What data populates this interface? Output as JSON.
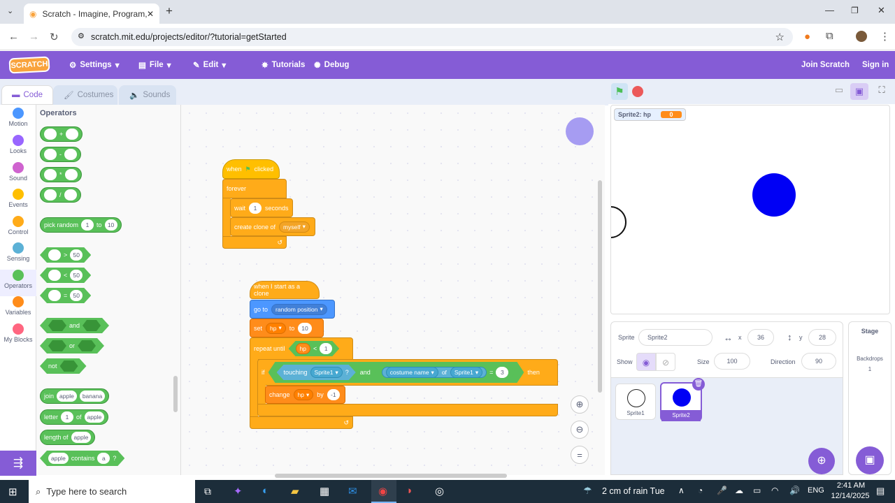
{
  "browser": {
    "tab_title": "Scratch - Imagine, Program, Sh",
    "url": "scratch.mit.edu/projects/editor/?tutorial=getStarted"
  },
  "menu": {
    "logo": "SCRATCH",
    "settings": "Settings",
    "file": "File",
    "edit": "Edit",
    "tutorials": "Tutorials",
    "debug": "Debug",
    "join": "Join Scratch",
    "signin": "Sign in"
  },
  "tabs": {
    "code": "Code",
    "costumes": "Costumes",
    "sounds": "Sounds"
  },
  "categories": [
    {
      "label": "Motion",
      "color": "#4c97ff"
    },
    {
      "label": "Looks",
      "color": "#9966ff"
    },
    {
      "label": "Sound",
      "color": "#cf63cf"
    },
    {
      "label": "Events",
      "color": "#ffbf00"
    },
    {
      "label": "Control",
      "color": "#ffab19"
    },
    {
      "label": "Sensing",
      "color": "#5cb1d6"
    },
    {
      "label": "Operators",
      "color": "#59c059"
    },
    {
      "label": "Variables",
      "color": "#ff8c1a"
    },
    {
      "label": "My Blocks",
      "color": "#ff6680"
    }
  ],
  "palette": {
    "heading": "Operators",
    "ops": [
      "+",
      "-",
      "*",
      "/"
    ],
    "pick": "pick random",
    "pick_from": "1",
    "to": "to",
    "pick_to": "10",
    "gt": ">",
    "lt": "<",
    "eq": "=",
    "fifty": "50",
    "and": "and",
    "or": "or",
    "not": "not",
    "join": "join",
    "apple": "apple",
    "banana": "banana",
    "letter": "letter",
    "one": "1",
    "of": "of",
    "length": "length of",
    "contains": "contains",
    "a": "a",
    "q": "?"
  },
  "script1": {
    "when": "when",
    "clicked": "clicked",
    "forever": "forever",
    "wait": "wait",
    "wait_val": "1",
    "seconds": "seconds",
    "create": "create clone of",
    "myself": "myself"
  },
  "script2": {
    "hat": "when I start as a clone",
    "goto": "go to",
    "random": "random position",
    "set": "set",
    "hp": "hp",
    "to": "to",
    "set_val": "10",
    "repeat": "repeat until",
    "lt": "<",
    "one": "1",
    "if": "if",
    "touching": "touching",
    "sprite1": "Sprite1",
    "q": "?",
    "and": "and",
    "costume": "costume name",
    "of": "of",
    "eq": "=",
    "three": "3",
    "then": "then",
    "change": "change",
    "by": "by",
    "change_val": "-1"
  },
  "stage": {
    "monitor_label": "Sprite2: hp",
    "monitor_value": "0"
  },
  "sprite": {
    "label": "Sprite",
    "name": "Sprite2",
    "x_label": "x",
    "x": "36",
    "y_label": "y",
    "y": "28",
    "show": "Show",
    "size_label": "Size",
    "size": "100",
    "dir_label": "Direction",
    "direction": "90",
    "sprites": [
      "Sprite1",
      "Sprite2"
    ]
  },
  "stagepanel": {
    "title": "Stage",
    "backdrops": "Backdrops",
    "count": "1"
  },
  "taskbar": {
    "search": "Type here to search",
    "weather": "2 cm of rain Tue",
    "lang": "ENG",
    "time": "2:41 AM",
    "date": "12/14/2025"
  }
}
